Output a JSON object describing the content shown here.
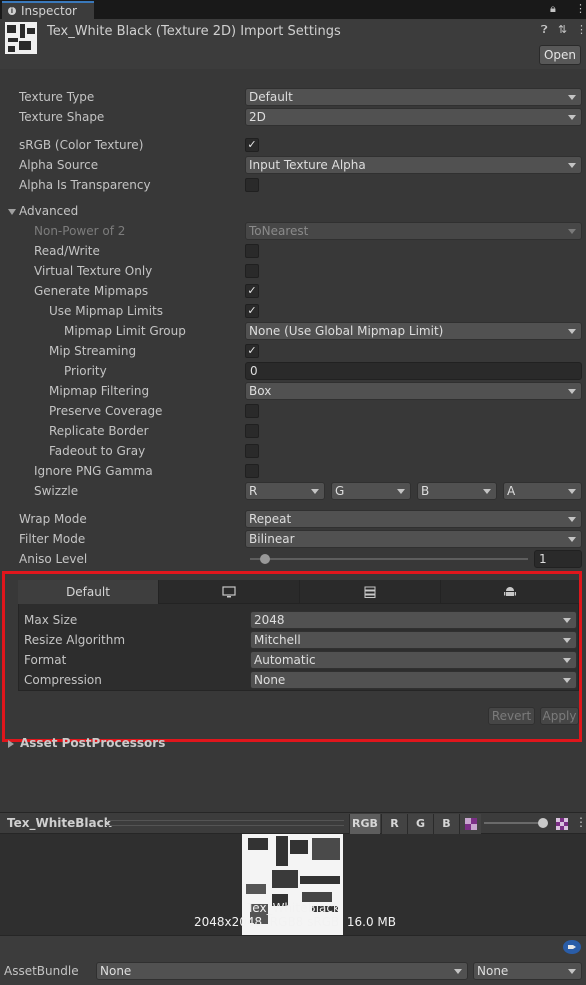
{
  "window": {
    "tab_label": "Inspector",
    "tab_icon": "info-icon",
    "lock_icon": "lock-icon",
    "menu_icon": "kebab-menu-icon"
  },
  "header": {
    "title": "Tex_White Black (Texture 2D) Import Settings",
    "help_icon": "help-icon",
    "preset_icon": "preset-sliders-icon",
    "open_label": "Open"
  },
  "settings": {
    "texture_type": {
      "label": "Texture Type",
      "value": "Default"
    },
    "texture_shape": {
      "label": "Texture Shape",
      "value": "2D"
    },
    "srgb": {
      "label": "sRGB (Color Texture)",
      "checked": true
    },
    "alpha_source": {
      "label": "Alpha Source",
      "value": "Input Texture Alpha"
    },
    "alpha_is_transparency": {
      "label": "Alpha Is Transparency",
      "checked": false
    },
    "advanced": {
      "label": "Advanced",
      "expanded": true
    },
    "non_power_of_2": {
      "label": "Non-Power of 2",
      "value": "ToNearest"
    },
    "read_write": {
      "label": "Read/Write",
      "checked": false
    },
    "virtual_texture_only": {
      "label": "Virtual Texture Only",
      "checked": false
    },
    "generate_mipmaps": {
      "label": "Generate Mipmaps",
      "checked": true
    },
    "use_mipmap_limits": {
      "label": "Use Mipmap Limits",
      "checked": true
    },
    "mipmap_limit_group": {
      "label": "Mipmap Limit Group",
      "value": "None (Use Global Mipmap Limit)"
    },
    "mip_streaming": {
      "label": "Mip Streaming",
      "checked": true
    },
    "priority": {
      "label": "Priority",
      "value": "0"
    },
    "mipmap_filtering": {
      "label": "Mipmap Filtering",
      "value": "Box"
    },
    "preserve_coverage": {
      "label": "Preserve Coverage",
      "checked": false
    },
    "replicate_border": {
      "label": "Replicate Border",
      "checked": false
    },
    "fadeout_to_gray": {
      "label": "Fadeout to Gray",
      "checked": false
    },
    "ignore_png_gamma": {
      "label": "Ignore PNG Gamma",
      "checked": false
    },
    "swizzle": {
      "label": "Swizzle",
      "r": "R",
      "g": "G",
      "b": "B",
      "a": "A"
    },
    "wrap_mode": {
      "label": "Wrap Mode",
      "value": "Repeat"
    },
    "filter_mode": {
      "label": "Filter Mode",
      "value": "Bilinear"
    },
    "aniso_level": {
      "label": "Aniso Level",
      "value": "1",
      "slider_fraction": 0.0
    }
  },
  "platform": {
    "tabs": [
      {
        "label": "Default",
        "icon": ""
      },
      {
        "label": "",
        "icon": "monitor-icon"
      },
      {
        "label": "",
        "icon": "server-icon"
      },
      {
        "label": "",
        "icon": "android-icon"
      }
    ],
    "max_size": {
      "label": "Max Size",
      "value": "2048"
    },
    "resize_algorithm": {
      "label": "Resize Algorithm",
      "value": "Mitchell"
    },
    "format": {
      "label": "Format",
      "value": "Automatic"
    },
    "compression": {
      "label": "Compression",
      "value": "None"
    },
    "revert_label": "Revert",
    "apply_label": "Apply"
  },
  "postprocessors": {
    "label": "Asset PostProcessors"
  },
  "preview": {
    "name": "Tex_WhiteBlack",
    "channels": [
      "RGB",
      "R",
      "G",
      "B"
    ],
    "alpha_icon": "alpha-checker-icon",
    "mip_icon": "mip-checker-icon",
    "thumb_label": "Tex_WhiteBlack",
    "info": "2048x2048  RGB8 sRGB  16.0 MB"
  },
  "footer": {
    "tag_icon": "asset-label-icon",
    "assetbundle_label": "AssetBundle",
    "bundle_value": "None",
    "variant_value": "None"
  }
}
